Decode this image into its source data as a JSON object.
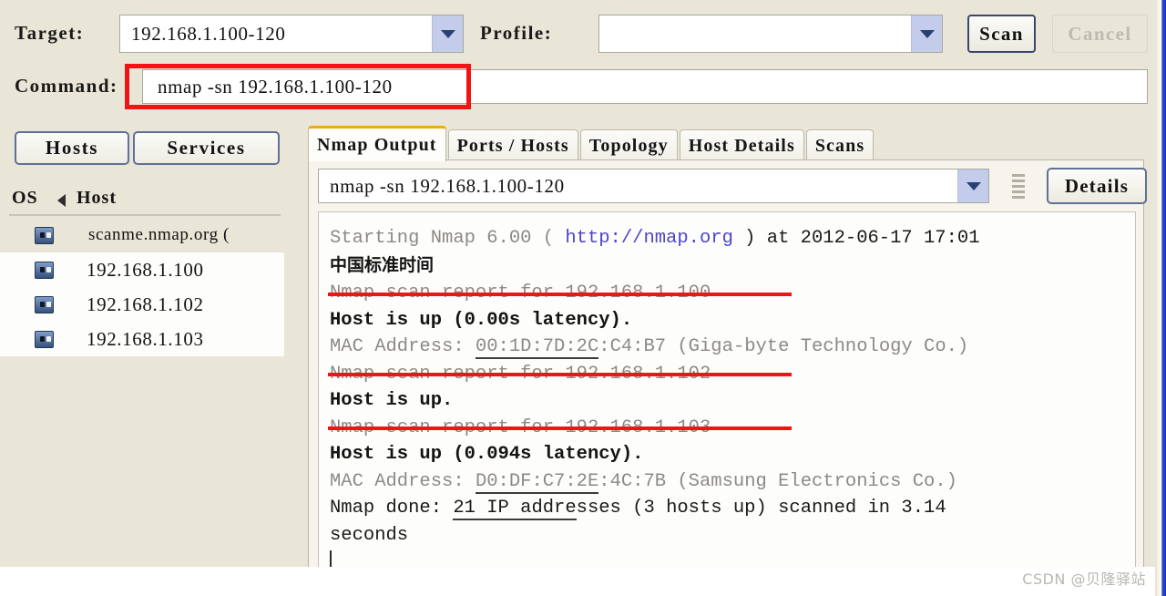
{
  "toolbar": {
    "target_label": "Target:",
    "target_value": "192.168.1.100-120",
    "profile_label": "Profile:",
    "profile_value": "",
    "scan_label": "Scan",
    "cancel_label": "Cancel",
    "command_label": "Command:",
    "command_value": "nmap -sn 192.168.1.100-120"
  },
  "sidebar": {
    "tabs": [
      {
        "label": "Hosts"
      },
      {
        "label": "Services"
      }
    ],
    "columns": {
      "os": "OS",
      "host": "Host"
    },
    "hosts": [
      {
        "name": "scanme.nmap.org (",
        "selected": true
      },
      {
        "name": "192.168.1.100",
        "selected": false
      },
      {
        "name": "192.168.1.102",
        "selected": false
      },
      {
        "name": "192.168.1.103",
        "selected": false
      }
    ]
  },
  "main": {
    "tabs": [
      {
        "label": "Nmap Output",
        "active": true
      },
      {
        "label": "Ports / Hosts",
        "active": false
      },
      {
        "label": "Topology",
        "active": false
      },
      {
        "label": "Host Details",
        "active": false
      },
      {
        "label": "Scans",
        "active": false
      }
    ],
    "command_selector_value": "nmap -sn 192.168.1.100-120",
    "details_label": "Details",
    "output": {
      "l1_a": "Starting Nmap 6.00 ( ",
      "l1_url": "http://nmap.org",
      "l1_b": " ) at 2012-06-17 17:01",
      "l2_cjk": "中国标准时间",
      "l3": "Nmap scan report for 192.168.1.100",
      "l4": "Host is up (0.00s latency).",
      "l5_a": "MAC Address: ",
      "l5_mac_u": "00:1D:7D:2C",
      "l5_b": ":C4:B7 (Giga-byte Technology Co.)",
      "l6": "Nmap scan report for 192.168.1.102",
      "l7": "Host is up.",
      "l8": "Nmap scan report for 192.168.1.103",
      "l9": "Host is up (0.094s latency).",
      "l10_a": "MAC Address: ",
      "l10_mac_u": "D0:DF:C7:2E",
      "l10_b": ":4C:7B (Samsung Electronics Co.)",
      "l11_a": "Nmap done: ",
      "l11_u": "21 IP addre",
      "l11_b": "sses (3 hosts up) scanned in 3.14",
      "l12": "seconds"
    }
  },
  "watermark": {
    "text": "CSDN @贝隆驿站"
  },
  "colors": {
    "window_bg": "#e9e5d7",
    "panel_bg": "#fdfdfb",
    "annotation_red": "#f11414",
    "tab_accent": "#f0a813",
    "link_blue": "#4d46c9",
    "muted_gray": "#8d8a85",
    "window_edge_blue": "#2f4fd8"
  }
}
